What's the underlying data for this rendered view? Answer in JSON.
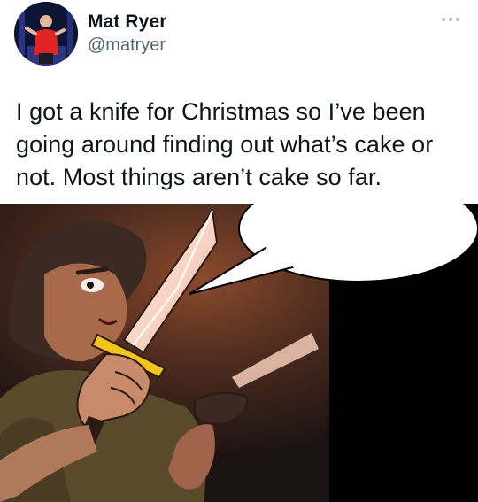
{
  "author": {
    "name": "Mat Ryer",
    "handle": "@matryer",
    "avatar_icon": "profile-photo-icon"
  },
  "menu": {
    "icon": "more-horizontal-icon"
  },
  "tweet": {
    "text": "I got a knife for Christmas so I’ve been\ngoing around finding out what’s cake or\nnot. Most things aren’t cake so far."
  },
  "media": {
    "description_icon": "comic-knife-image"
  },
  "colors": {
    "text_primary": "#0f1419",
    "text_secondary": "#536471",
    "background": "#ffffff"
  }
}
